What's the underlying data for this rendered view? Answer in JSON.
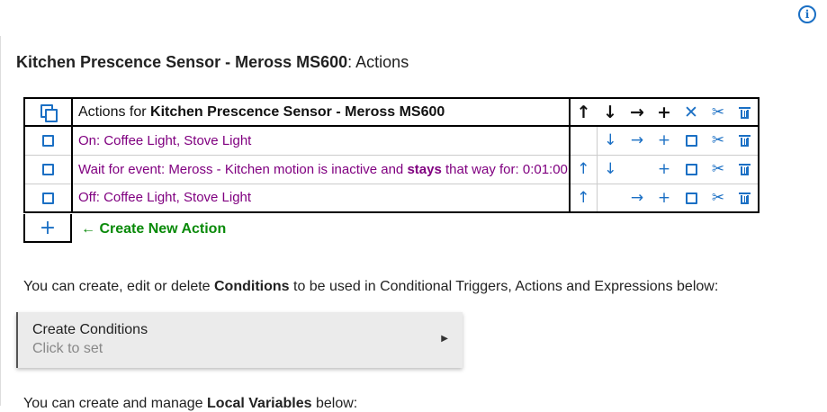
{
  "header": {
    "device_name": "Kitchen Prescence Sensor - Meross MS600",
    "title_suffix": ": Actions",
    "info_icon": "info-circle-icon"
  },
  "actions_table": {
    "header_prefix": "Actions for ",
    "header_device": "Kitchen Prescence Sensor - Meross MS600",
    "header_icons": [
      "arrow-up-icon",
      "arrow-down-icon",
      "arrow-right-icon",
      "plus-icon",
      "close-icon",
      "scissors-icon",
      "trash-icon"
    ],
    "rows": [
      {
        "label": "On: Coffee Light, Stove Light"
      },
      {
        "label_pre": "Wait for event: Meross - Kitchen motion is inactive and ",
        "label_bold": "stays",
        "label_post": " that way for: 0:01:00"
      },
      {
        "label": "Off: Coffee Light, Stove Light"
      }
    ],
    "create_new_label": "← Create New Action"
  },
  "conditions": {
    "desc_pre": "You can create, edit or delete ",
    "desc_bold": "Conditions",
    "desc_post": " to be used in Conditional Triggers, Actions and Expressions below:",
    "button_title": "Create Conditions",
    "button_sub": "Click to set"
  },
  "variables": {
    "desc_pre": "You can create and manage ",
    "desc_bold": "Local Variables",
    "desc_post": " below:"
  },
  "colors": {
    "accent": "#1a6fc4",
    "action_link": "#800080",
    "create_new": "#0a8a0a"
  }
}
